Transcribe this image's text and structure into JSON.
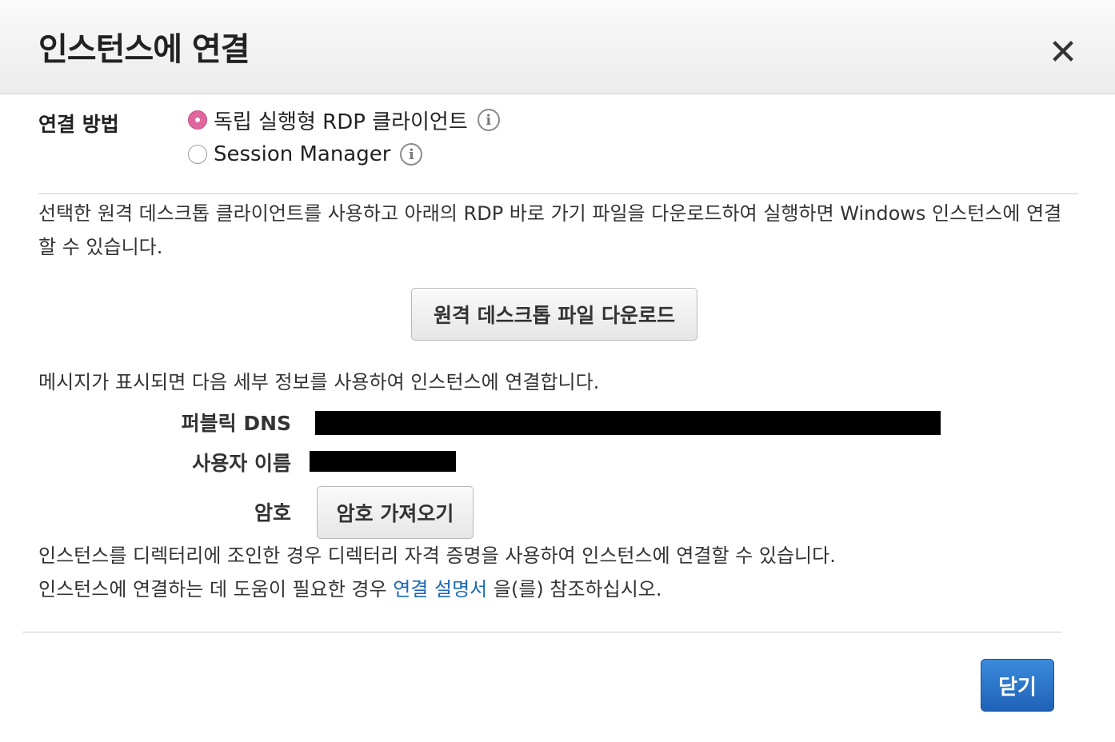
{
  "dialog": {
    "title": "인스턴스에 연결",
    "close_icon": "close-icon"
  },
  "method": {
    "label": "연결 방법",
    "options": [
      {
        "label": "독립 실행형 RDP 클라이언트",
        "selected": true,
        "info_icon": "info-icon"
      },
      {
        "label": "Session Manager",
        "selected": false,
        "info_icon": "info-icon"
      }
    ]
  },
  "description": "선택한 원격 데스크톱 클라이언트를 사용하고 아래의 RDP 바로 가기 파일을 다운로드하여 실행하면 Windows 인스턴스에 연결할 수 있습니다.",
  "download_button": "원격 데스크톱 파일 다운로드",
  "prompt": "메시지가 표시되면 다음 세부 정보를 사용하여 인스턴스에 연결합니다.",
  "fields": {
    "public_dns_label": "퍼블릭 DNS",
    "username_label": "사용자 이름",
    "password_label": "암호",
    "get_password_button": "암호 가져오기"
  },
  "footer": {
    "line1": "인스턴스를 디렉터리에 조인한 경우 디렉터리 자격 증명을 사용하여 인스턴스에 연결할 수 있습니다.",
    "line2_prefix": "인스턴스에 연결하는 데 도움이 필요한 경우 ",
    "line2_link": "연결 설명서",
    "line2_suffix": " 을(를) 참조하십시오."
  },
  "close_button": "닫기",
  "colors": {
    "radio_selected": "#e0669e",
    "link": "#1a67b5",
    "primary_button": "#2a72c8"
  }
}
